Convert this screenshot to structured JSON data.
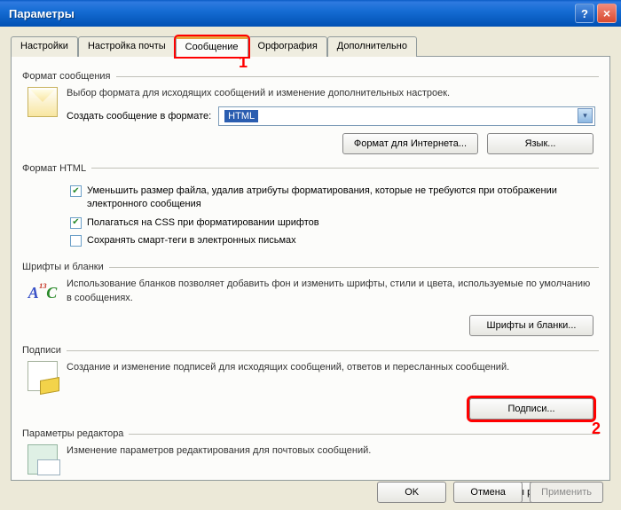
{
  "window": {
    "title": "Параметры"
  },
  "tabs": {
    "items": [
      {
        "label": "Настройки"
      },
      {
        "label": "Настройка почты"
      },
      {
        "label": "Сообщение"
      },
      {
        "label": "Орфография"
      },
      {
        "label": "Дополнительно"
      }
    ],
    "active_index": 2
  },
  "callouts": {
    "tab": "1",
    "signatures": "2"
  },
  "groups": {
    "format_msg": {
      "legend": "Формат сообщения",
      "desc": "Выбор формата для исходящих сообщений и изменение дополнительных настроек.",
      "create_label": "Создать сообщение в формате:",
      "select_value": "HTML",
      "btn_internet": "Формат для Интернета...",
      "btn_lang": "Язык..."
    },
    "format_html": {
      "legend": "Формат HTML",
      "check1": "Уменьшить размер файла, удалив атрибуты форматирования, которые не требуются при отображении электронного сообщения",
      "check2": "Полагаться на CSS при форматировании шрифтов",
      "check3": "Сохранять смарт-теги в электронных письмах"
    },
    "fonts": {
      "legend": "Шрифты и бланки",
      "desc": "Использование бланков позволяет добавить фон и изменить шрифты, стили и цвета, используемые по умолчанию в сообщениях.",
      "btn": "Шрифты и бланки..."
    },
    "signatures": {
      "legend": "Подписи",
      "desc": "Создание и изменение подписей для исходящих сообщений, ответов и пересланных сообщений.",
      "btn": "Подписи..."
    },
    "editor": {
      "legend": "Параметры редактора",
      "desc": "Изменение параметров редактирования для почтовых сообщений.",
      "btn": "Параметры редактора..."
    }
  },
  "buttons": {
    "ok": "OK",
    "cancel": "Отмена",
    "apply": "Применить"
  }
}
